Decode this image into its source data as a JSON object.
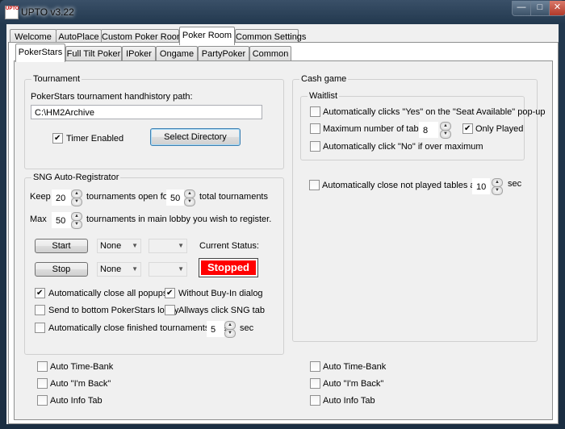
{
  "window": {
    "title": "UPTO  v3.22",
    "logo_text": "UPTO",
    "close_glyph": "✕",
    "max_glyph": "□",
    "min_glyph": "—"
  },
  "main_tabs": [
    "Welcome",
    "AutoPlace",
    "Custom Poker Room",
    "Poker Room",
    "Common Settings"
  ],
  "room_tabs": [
    "PokerStars",
    "Full Tilt Poker",
    "IPoker",
    "Ongame",
    "PartyPoker",
    "Common"
  ],
  "tournament": {
    "title": "Tournament",
    "path_label": "PokerStars tournament handhistory path:",
    "path_value": "C:\\HM2Archive",
    "timer_label": "Timer Enabled",
    "select_dir_label": "Select Directory"
  },
  "sng": {
    "title": "SNG Auto-Registrator",
    "keep_label": "Keep",
    "keep_value": "20",
    "open_for_label": "tournaments open for",
    "open_for_value": "50",
    "total_label": "total tournaments",
    "max_label": "Max",
    "max_value": "50",
    "main_lobby_label": "tournaments in main lobby you wish to register.",
    "start_label": "Start",
    "stop_label": "Stop",
    "combo_none_1": "None",
    "combo_none_2": "None",
    "current_status_label": "Current Status:",
    "status_value": "Stopped",
    "auto_close_popups_label": "Automatically close all popups",
    "without_buyin_label": "Without Buy-In dialog",
    "send_bottom_label": "Send to bottom PokerStars lobby",
    "always_sng_label": "Allways click SNG tab",
    "auto_close_finished_label": "Automatically close finished tournaments after",
    "auto_close_finished_value": "5",
    "sec_label": "sec"
  },
  "cash": {
    "title": "Cash game",
    "waitlist_title": "Waitlist",
    "auto_yes_label": "Automatically clicks \"Yes\" on the \"Seat Available\" pop-up",
    "max_tables_label": "Maximum number of tables:",
    "max_tables_value": "8",
    "only_played_label": "Only Played",
    "auto_no_label": "Automatically click \"No\" if over maximum",
    "close_not_played_label": "Automatically close not played tables after",
    "close_not_played_value": "10",
    "sec_label": "sec"
  },
  "bottom_left": {
    "time_bank": "Auto Time-Bank",
    "im_back": "Auto \"I'm Back\"",
    "info_tab": "Auto Info Tab"
  },
  "bottom_right": {
    "time_bank": "Auto Time-Bank",
    "im_back": "Auto \"I'm Back\"",
    "info_tab": "Auto Info Tab"
  },
  "icons": {
    "spin_up": "▲",
    "spin_down": "▼",
    "combo_arrow": "▼"
  }
}
